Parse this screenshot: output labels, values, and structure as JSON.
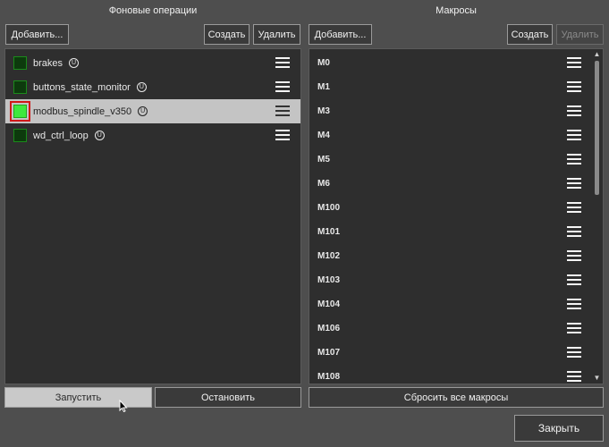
{
  "background_ops": {
    "title": "Фоновые операции",
    "add_label": "Добавить...",
    "create_label": "Создать",
    "delete_label": "Удалить",
    "items": [
      {
        "name": "brakes",
        "enabled": false,
        "selected": false
      },
      {
        "name": "buttons_state_monitor",
        "enabled": false,
        "selected": false
      },
      {
        "name": "modbus_spindle_v350",
        "enabled": true,
        "selected": true
      },
      {
        "name": "wd_ctrl_loop",
        "enabled": false,
        "selected": false
      }
    ],
    "start_label": "Запустить",
    "stop_label": "Остановить"
  },
  "macros": {
    "title": "Макросы",
    "add_label": "Добавить...",
    "create_label": "Создать",
    "delete_label": "Удалить",
    "items": [
      "M0",
      "M1",
      "M3",
      "M4",
      "M5",
      "M6",
      "M100",
      "M101",
      "M102",
      "M103",
      "M104",
      "M106",
      "M107",
      "M108"
    ],
    "reset_label": "Сбросить все макросы"
  },
  "close_label": "Закрыть",
  "icons": {
    "info": "info-circle-icon",
    "menu": "hamburger-menu-icon",
    "check_on_color": "#3ee83e",
    "check_off_color": "#0d3a0d",
    "highlight_color": "#d01818"
  }
}
